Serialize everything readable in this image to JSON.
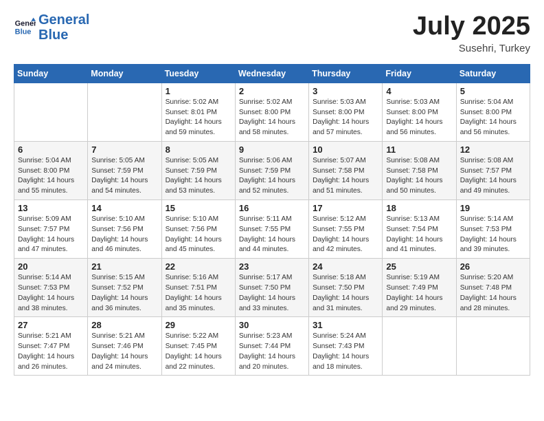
{
  "logo": {
    "line1": "General",
    "line2": "Blue"
  },
  "title": "July 2025",
  "subtitle": "Susehri, Turkey",
  "header_days": [
    "Sunday",
    "Monday",
    "Tuesday",
    "Wednesday",
    "Thursday",
    "Friday",
    "Saturday"
  ],
  "weeks": [
    [
      {
        "day": "",
        "info": ""
      },
      {
        "day": "",
        "info": ""
      },
      {
        "day": "1",
        "info": "Sunrise: 5:02 AM\nSunset: 8:01 PM\nDaylight: 14 hours\nand 59 minutes."
      },
      {
        "day": "2",
        "info": "Sunrise: 5:02 AM\nSunset: 8:00 PM\nDaylight: 14 hours\nand 58 minutes."
      },
      {
        "day": "3",
        "info": "Sunrise: 5:03 AM\nSunset: 8:00 PM\nDaylight: 14 hours\nand 57 minutes."
      },
      {
        "day": "4",
        "info": "Sunrise: 5:03 AM\nSunset: 8:00 PM\nDaylight: 14 hours\nand 56 minutes."
      },
      {
        "day": "5",
        "info": "Sunrise: 5:04 AM\nSunset: 8:00 PM\nDaylight: 14 hours\nand 56 minutes."
      }
    ],
    [
      {
        "day": "6",
        "info": "Sunrise: 5:04 AM\nSunset: 8:00 PM\nDaylight: 14 hours\nand 55 minutes."
      },
      {
        "day": "7",
        "info": "Sunrise: 5:05 AM\nSunset: 7:59 PM\nDaylight: 14 hours\nand 54 minutes."
      },
      {
        "day": "8",
        "info": "Sunrise: 5:05 AM\nSunset: 7:59 PM\nDaylight: 14 hours\nand 53 minutes."
      },
      {
        "day": "9",
        "info": "Sunrise: 5:06 AM\nSunset: 7:59 PM\nDaylight: 14 hours\nand 52 minutes."
      },
      {
        "day": "10",
        "info": "Sunrise: 5:07 AM\nSunset: 7:58 PM\nDaylight: 14 hours\nand 51 minutes."
      },
      {
        "day": "11",
        "info": "Sunrise: 5:08 AM\nSunset: 7:58 PM\nDaylight: 14 hours\nand 50 minutes."
      },
      {
        "day": "12",
        "info": "Sunrise: 5:08 AM\nSunset: 7:57 PM\nDaylight: 14 hours\nand 49 minutes."
      }
    ],
    [
      {
        "day": "13",
        "info": "Sunrise: 5:09 AM\nSunset: 7:57 PM\nDaylight: 14 hours\nand 47 minutes."
      },
      {
        "day": "14",
        "info": "Sunrise: 5:10 AM\nSunset: 7:56 PM\nDaylight: 14 hours\nand 46 minutes."
      },
      {
        "day": "15",
        "info": "Sunrise: 5:10 AM\nSunset: 7:56 PM\nDaylight: 14 hours\nand 45 minutes."
      },
      {
        "day": "16",
        "info": "Sunrise: 5:11 AM\nSunset: 7:55 PM\nDaylight: 14 hours\nand 44 minutes."
      },
      {
        "day": "17",
        "info": "Sunrise: 5:12 AM\nSunset: 7:55 PM\nDaylight: 14 hours\nand 42 minutes."
      },
      {
        "day": "18",
        "info": "Sunrise: 5:13 AM\nSunset: 7:54 PM\nDaylight: 14 hours\nand 41 minutes."
      },
      {
        "day": "19",
        "info": "Sunrise: 5:14 AM\nSunset: 7:53 PM\nDaylight: 14 hours\nand 39 minutes."
      }
    ],
    [
      {
        "day": "20",
        "info": "Sunrise: 5:14 AM\nSunset: 7:53 PM\nDaylight: 14 hours\nand 38 minutes."
      },
      {
        "day": "21",
        "info": "Sunrise: 5:15 AM\nSunset: 7:52 PM\nDaylight: 14 hours\nand 36 minutes."
      },
      {
        "day": "22",
        "info": "Sunrise: 5:16 AM\nSunset: 7:51 PM\nDaylight: 14 hours\nand 35 minutes."
      },
      {
        "day": "23",
        "info": "Sunrise: 5:17 AM\nSunset: 7:50 PM\nDaylight: 14 hours\nand 33 minutes."
      },
      {
        "day": "24",
        "info": "Sunrise: 5:18 AM\nSunset: 7:50 PM\nDaylight: 14 hours\nand 31 minutes."
      },
      {
        "day": "25",
        "info": "Sunrise: 5:19 AM\nSunset: 7:49 PM\nDaylight: 14 hours\nand 29 minutes."
      },
      {
        "day": "26",
        "info": "Sunrise: 5:20 AM\nSunset: 7:48 PM\nDaylight: 14 hours\nand 28 minutes."
      }
    ],
    [
      {
        "day": "27",
        "info": "Sunrise: 5:21 AM\nSunset: 7:47 PM\nDaylight: 14 hours\nand 26 minutes."
      },
      {
        "day": "28",
        "info": "Sunrise: 5:21 AM\nSunset: 7:46 PM\nDaylight: 14 hours\nand 24 minutes."
      },
      {
        "day": "29",
        "info": "Sunrise: 5:22 AM\nSunset: 7:45 PM\nDaylight: 14 hours\nand 22 minutes."
      },
      {
        "day": "30",
        "info": "Sunrise: 5:23 AM\nSunset: 7:44 PM\nDaylight: 14 hours\nand 20 minutes."
      },
      {
        "day": "31",
        "info": "Sunrise: 5:24 AM\nSunset: 7:43 PM\nDaylight: 14 hours\nand 18 minutes."
      },
      {
        "day": "",
        "info": ""
      },
      {
        "day": "",
        "info": ""
      }
    ]
  ]
}
